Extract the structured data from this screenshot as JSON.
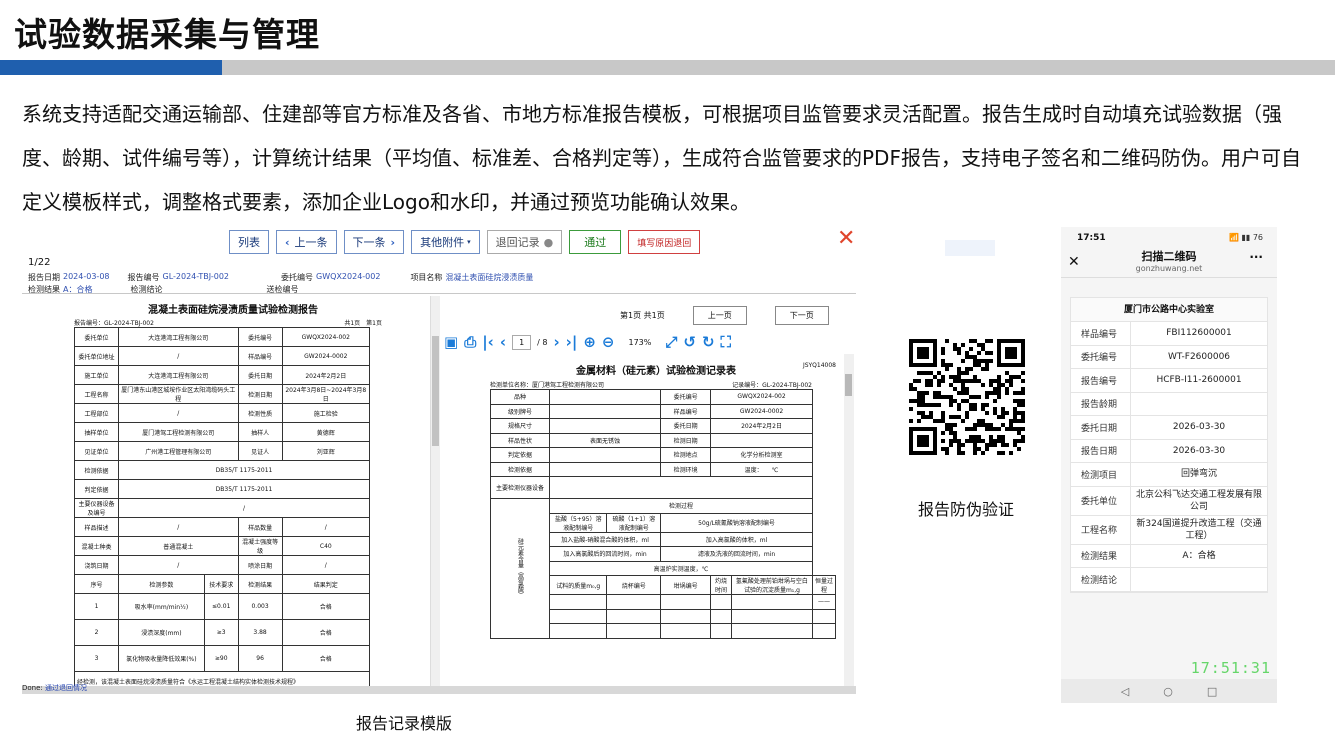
{
  "page": {
    "title": "试验数据采集与管理",
    "description": "系统支持适配交通运输部、住建部等官方标准及各省、市地方标准报告模板，可根据项目监管要求灵活配置。报告生成时自动填充试验数据（强度、龄期、试件编号等），计算统计结果（平均值、标准差、合格判定等），生成符合监管要求的PDF报告，支持电子签名和二维码防伪。用户可自定义模板样式，调整格式要素，添加企业Logo和水印，并通过预览功能确认效果。"
  },
  "colors": {
    "accent": "#1f5fae",
    "bar_gray": "#c8c8c8",
    "clock_green": "#66d66a"
  },
  "report": {
    "toolbar": {
      "list": "列表",
      "prev": "上一条",
      "next": "下一条",
      "attachments": "其他附件",
      "return_record": "退回记录",
      "pass": "通过",
      "fill_reason": "填写原因退回"
    },
    "page_count": "1/22",
    "info": {
      "report_date_label": "报告日期",
      "report_date": "2024-03-08",
      "report_no_label": "报告编号",
      "report_no": "GL-2024-TBJ-002",
      "entrust_no_label": "委托编号",
      "entrust_no": "GWQX2024-002",
      "project_label": "项目名称",
      "project": "混凝土表面硅烷浸渍质量",
      "result_label": "检测结果",
      "result": "A：合格",
      "conclusion_label": "检测结论",
      "inspector_label": "送检编号"
    },
    "left_doc": {
      "title": "混凝土表面硅烷浸渍质量试验检测报告",
      "sub_left": "报告编号：GL-2024-TBJ-002",
      "sub_right": "共1页　第1页",
      "rows": [
        [
          "委托单位",
          "大连港湾工程有限公司",
          "委托编号",
          "GWQX2024-002"
        ],
        [
          "委托单位地址",
          "/",
          "样品编号",
          "GW2024-0002"
        ],
        [
          "施工单位",
          "大连港湾工程有限公司",
          "委托日期",
          "2024年2月2日"
        ],
        [
          "工程名称",
          "厦门港东山港区城垵作业区太阳湾缆码头工程",
          "检测日期",
          "2024年3月8日~2024年3月8日"
        ],
        [
          "工程部位",
          "/",
          "检测性质",
          "施工检验"
        ],
        [
          "抽样单位",
          "厦门港驾工程检测有限公司",
          "抽样人",
          "黄德辉"
        ],
        [
          "见证单位",
          "广州港工程管理有限公司",
          "见证人",
          "刘亚辉"
        ]
      ],
      "basis_label": "检测依据",
      "basis": "DB35/T 1175-2011",
      "judge_label": "判定依据",
      "judge": "DB35/T 1175-2011",
      "equip_label": "主要仪器设备及编号",
      "equip": "/",
      "rows2": [
        [
          "样品描述",
          "/",
          "样品数量",
          "/"
        ],
        [
          "混凝土种类",
          "普通混凝土",
          "混凝土强度等级",
          "C40"
        ],
        [
          "浇筑日期",
          "/",
          "喷涂日期",
          "/"
        ]
      ],
      "param_header": [
        "序号",
        "检测参数",
        "技术要求",
        "检测结果",
        "结果判定"
      ],
      "params": [
        [
          "1",
          "吸水率(mm/min½)",
          "≤0.01",
          "0.003",
          "合格"
        ],
        [
          "2",
          "浸渍深度(mm)",
          "≥3",
          "3.88",
          "合格"
        ],
        [
          "3",
          "氯化物吸收量降低效果(%)",
          "≥90",
          "96",
          "合格"
        ]
      ],
      "footnote": "经检测，该混凝土表面硅烷浸渍质量符合《水运工程混凝土结构实体检测技术规程》"
    },
    "right_doc": {
      "page_info": "第1页 共1页",
      "prev_page": "上一页",
      "next_page": "下一页",
      "page_field": "1",
      "page_total": "/ 8",
      "zoom": "173%",
      "title": "金属材料（硅元素）试验检测记录表",
      "code": "JSYQ14008",
      "sub_left": "检测单位名称：厦门港驾工程检测有限公司",
      "sub_right": "记录编号：GL-2024-TBJ-002",
      "rows": [
        [
          "品种",
          "",
          "委托编号",
          "GWQX2024-002"
        ],
        [
          "级别牌号",
          "",
          "样品编号",
          "GW2024-0002"
        ],
        [
          "规格尺寸",
          "",
          "委托日期",
          "2024年2月2日"
        ],
        [
          "样品性状",
          "表面无锈蚀",
          "检测日期",
          ""
        ],
        [
          "判定依据",
          "",
          "检测地点",
          "化学分析检测室"
        ],
        [
          "检测依据",
          "",
          "检测环境",
          "温度：　　℃"
        ]
      ],
      "equip_label": "主要检测仪器设备",
      "process_label": "检测过程",
      "process_rows": [
        [
          "盐酸（5+95）溶液配制编号",
          "硫酸（1+1）溶液配制编号",
          "50g/L硫氰酸钠溶液配制编号"
        ],
        [
          "加入盐酸-硝酸混合酸的体积，ml",
          "加入高氯酸的体积，ml"
        ],
        [
          "加入高氯酸后的回流时间，min",
          "滤液及洗液的回流时间，min"
        ]
      ],
      "temp_label": "高温炉实测温度，℃",
      "cols": [
        "试料的质量m₀,g",
        "烧杯编号",
        "坩埚编号",
        "灼烧时间",
        "氢氟酸处理前铂坩埚与空白试验的沉淀质量m₁,g",
        "恒量过程"
      ],
      "side_label": "硅元素含量（高氯酸）",
      "dash": "——"
    },
    "status_label": "Done:",
    "status_link": "通过退回情况"
  },
  "captions": {
    "report": "报告记录模版",
    "qr": "报告防伪验证"
  },
  "phone": {
    "time": "17:51",
    "signal": "📶 ▮▮ 76",
    "title": "扫描二维码",
    "url": "gonzhuwang.net",
    "card_title": "厦门市公路中心实验室",
    "rows": [
      [
        "样品编号",
        "FBI112600001"
      ],
      [
        "委托编号",
        "WT-F2600006"
      ],
      [
        "报告编号",
        "HCFB-I11-2600001"
      ],
      [
        "报告龄期",
        ""
      ],
      [
        "委托日期",
        "2026-03-30"
      ],
      [
        "报告日期",
        "2026-03-30"
      ],
      [
        "检测项目",
        "回弹弯沉"
      ],
      [
        "委托单位",
        "北京公科飞达交通工程发展有限公司"
      ],
      [
        "工程名称",
        "新324国道提升改造工程（交通工程）"
      ],
      [
        "检测结果",
        "A：合格"
      ],
      [
        "检测结论",
        ""
      ]
    ],
    "clock": "17:51:31",
    "nav_back": "◁",
    "nav_home": "○",
    "nav_recent": "□"
  }
}
